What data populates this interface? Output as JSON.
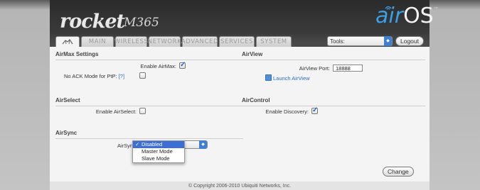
{
  "brand": {
    "product_name": "rocket",
    "model": "M365",
    "os_logo_air": "air",
    "os_logo_os": "OS",
    "os_logo_tm": "™"
  },
  "tabs": [
    {
      "label": "",
      "icon": "ubiquiti-logo-icon",
      "active": true
    },
    {
      "label": "MAIN",
      "active": false
    },
    {
      "label": "WIRELESS",
      "active": false
    },
    {
      "label": "NETWORK",
      "active": false
    },
    {
      "label": "ADVANCED",
      "active": false
    },
    {
      "label": "SERVICES",
      "active": false
    },
    {
      "label": "SYSTEM",
      "active": false
    }
  ],
  "toolbar": {
    "tools_value": "Tools:",
    "logout_label": "Logout"
  },
  "airmax": {
    "title": "AirMax Settings",
    "enable_label": "Enable AirMax:",
    "enable_checked": true,
    "noack_label": "No ACK Mode for PtP:",
    "noack_help": "[?]",
    "noack_checked": false
  },
  "airview": {
    "title": "AirView",
    "port_label": "AirView Port:",
    "port_value": "18888",
    "launch_label": "Launch AirView"
  },
  "airselect": {
    "title": "AirSelect",
    "enable_label": "Enable AirSelect:",
    "enable_checked": false
  },
  "aircontrol": {
    "title": "AirControl",
    "discovery_label": "Enable Discovery:",
    "discovery_checked": true
  },
  "airsync": {
    "title": "AirSync",
    "label": "AirSync:",
    "options": [
      "Disabled",
      "Master Mode",
      "Slave Mode"
    ],
    "selected": "Disabled",
    "check_mark": "✓"
  },
  "actions": {
    "change_label": "Change"
  },
  "footer": {
    "copyright": "© Copyright 2006-2010 Ubiquiti Networks, Inc."
  },
  "colors": {
    "accent_blue": "#3b6fd6",
    "logo_blue": "#3ba0e6",
    "header_dark": "#2b2b2b",
    "panel_bg": "#f4f4f4"
  }
}
